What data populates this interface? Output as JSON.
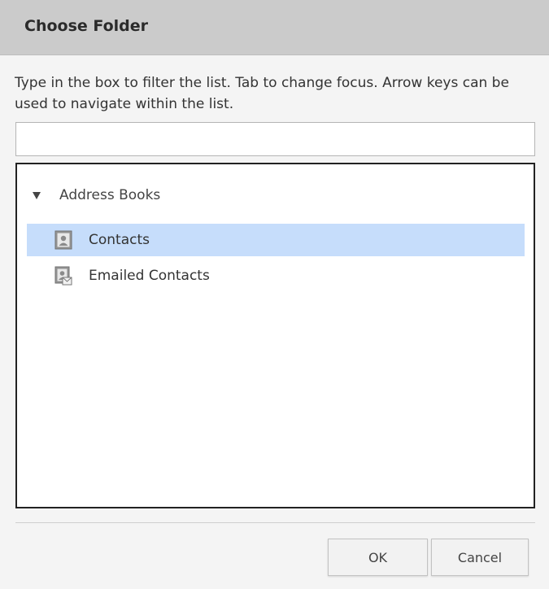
{
  "dialog": {
    "title": "Choose Folder",
    "instructions": "Type in the box to filter the list. Tab to change focus. Arrow keys can be used to navigate within the list.",
    "filter": {
      "value": "",
      "placeholder": ""
    }
  },
  "tree": {
    "root": {
      "label": "Address Books",
      "icon": "triangle-down-icon",
      "expanded": true
    },
    "items": [
      {
        "label": "Contacts",
        "icon": "contacts-book-icon",
        "selected": true
      },
      {
        "label": "Emailed Contacts",
        "icon": "emailed-contacts-icon",
        "selected": false
      }
    ]
  },
  "buttons": {
    "ok": "OK",
    "cancel": "Cancel"
  },
  "colors": {
    "titlebar": "#cbcbcb",
    "selection": "#c6ddfb",
    "tree_border": "#222222",
    "dialog_background": "#f4f4f4"
  }
}
